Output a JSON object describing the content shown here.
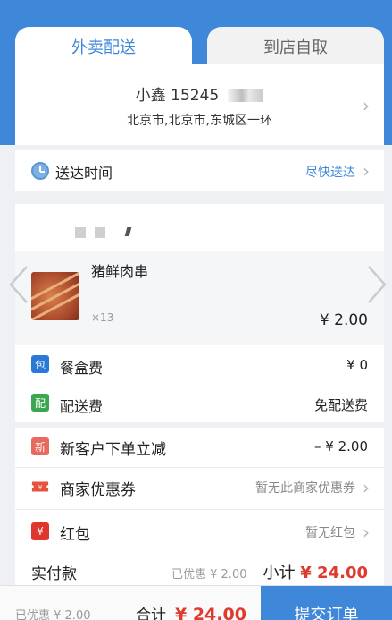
{
  "tabs": [
    {
      "label": "外卖配送",
      "active": true
    },
    {
      "label": "到店自取",
      "active": false
    }
  ],
  "address": {
    "name_phone": "小鑫   15245",
    "address": "北京市,北京市,东城区一环"
  },
  "delivery": {
    "label": "送达时间",
    "value": "尽快送达"
  },
  "order_item": {
    "name": "猪鲜肉串",
    "quantity": "×13",
    "price": "¥ 2.00"
  },
  "fees": [
    {
      "icon": "包",
      "icon_color": "#2a79d6",
      "label": "餐盒费",
      "value": "¥ 0"
    },
    {
      "icon": "配",
      "icon_color": "#3aa64f",
      "label": "配送费",
      "value": "免配送费"
    }
  ],
  "promos": [
    {
      "icon": "新",
      "icon_color": "#e86a5f",
      "label": "新客户下单立减",
      "value": "– ¥ 2.00"
    },
    {
      "icon": "ticket-icon",
      "icon_color": "#e5533d",
      "label": "商家优惠券",
      "value": "暂无此商家优惠券"
    },
    {
      "icon": "¥",
      "icon_color": "#e0362e",
      "label": "红包",
      "value": "暂无红包"
    }
  ],
  "payment": {
    "label": "实付款",
    "saved": "已优惠 ¥ 2.00",
    "subtotal_label": "小计",
    "subtotal_value": "¥ 24.00"
  },
  "bottom": {
    "saved": "已优惠 ¥ 2.00",
    "total_label": "合计",
    "total_value": "¥ 24.00",
    "submit": "提交订单"
  },
  "colors": {
    "accent": "#3e87d9",
    "price_red": "#e03a2f"
  }
}
